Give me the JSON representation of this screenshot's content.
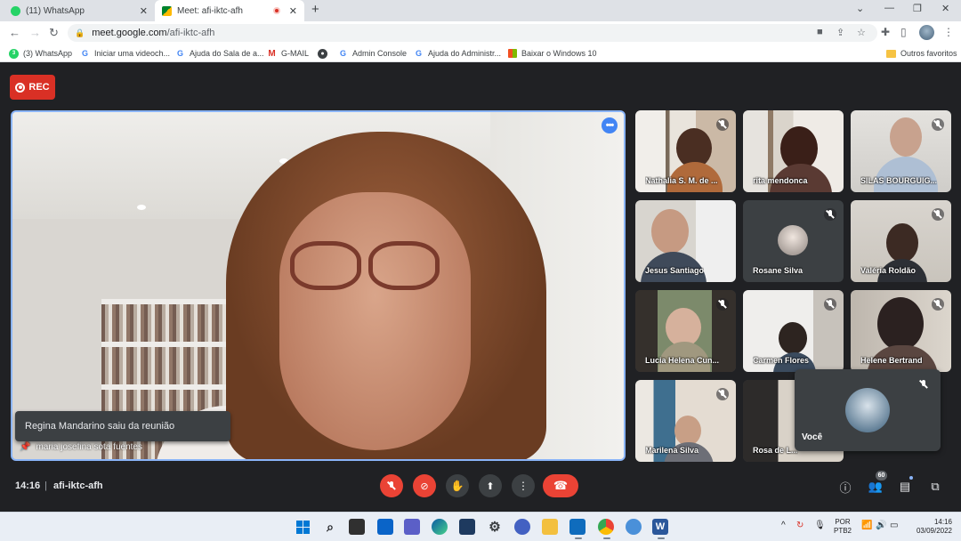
{
  "browser": {
    "tabs": [
      {
        "title": "(11) WhatsApp",
        "close": "✕"
      },
      {
        "title": "Meet: afi-iktc-afh",
        "close": "✕"
      }
    ],
    "new_tab": "+",
    "window_controls": {
      "menu": "⌄",
      "minimize": "—",
      "maximize": "❐",
      "close": "✕"
    },
    "url_host": "meet.google.com",
    "url_path": "/afi-iktc-afh",
    "bookmarks": [
      {
        "label": "(3) WhatsApp",
        "icon": "whatsapp-icon",
        "glyph": "3"
      },
      {
        "label": "Iniciar uma videoch...",
        "icon": "google-icon",
        "glyph": "G"
      },
      {
        "label": "Ajuda do Sala de a...",
        "icon": "google-icon",
        "glyph": "G"
      },
      {
        "label": "G-MAIL",
        "icon": "gmail-icon",
        "glyph": "M"
      },
      {
        "label": "",
        "icon": "globe-icon",
        "glyph": "●"
      },
      {
        "label": "Admin Console",
        "icon": "google-icon",
        "glyph": "G"
      },
      {
        "label": "Ajuda do Administr...",
        "icon": "google-icon",
        "glyph": "G"
      },
      {
        "label": "Baixar o Windows 10",
        "icon": "windows-icon",
        "glyph": ""
      }
    ],
    "other_bookmarks": "Outros favoritos"
  },
  "meet": {
    "rec_label": "REC",
    "main_speaker": "maria josefina sota fuentes",
    "toast": "Regina Mandarino saiu da reunião",
    "participants": [
      {
        "name": "Nathalia S. M. de ...",
        "muted": true
      },
      {
        "name": "rita mendonca",
        "muted": false
      },
      {
        "name": "SILAS BOURGUIG...",
        "muted": true
      },
      {
        "name": "Jesus Santiago",
        "muted": false
      },
      {
        "name": "Rosane Silva",
        "muted": true
      },
      {
        "name": "Valéria Roldão",
        "muted": true
      },
      {
        "name": "Lucia Helena Cun...",
        "muted": true
      },
      {
        "name": "Carmen Flores",
        "muted": true
      },
      {
        "name": "Helene Bertrand",
        "muted": true
      },
      {
        "name": "Marilena Silva",
        "muted": true
      },
      {
        "name": "Rosa de L...",
        "muted": false
      }
    ],
    "self_name": "Você",
    "time": "14:16",
    "separator": "|",
    "meeting_code": "afi-iktc-afh",
    "people_count": "60"
  },
  "taskbar": {
    "lang_top": "POR",
    "lang_bottom": "PTB2",
    "clock_time": "14:16",
    "clock_date": "03/09/2022",
    "tray_chevron": "^"
  },
  "colors": {
    "accent": "#8ab4f8",
    "danger": "#ea4335",
    "meet_bg": "#202124",
    "tile_bg": "#3c4043"
  }
}
